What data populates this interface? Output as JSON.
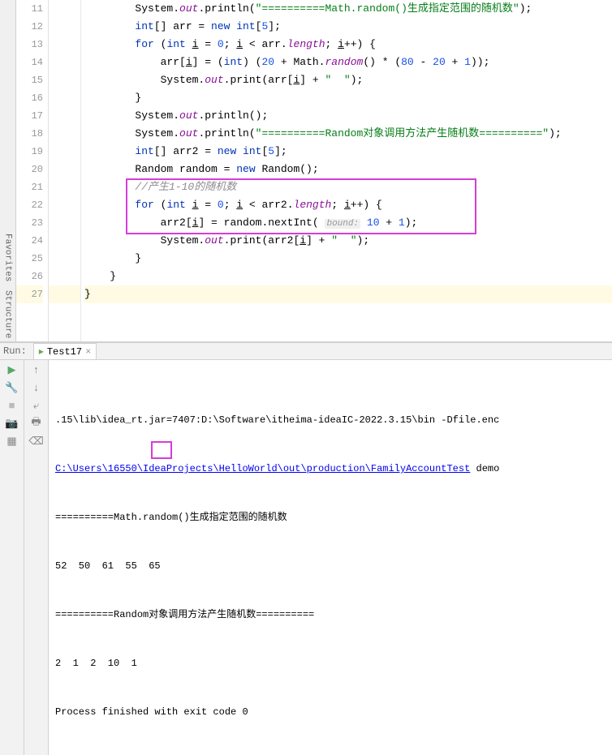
{
  "sidebar": {
    "structure": "Structure",
    "favorites": "Favorites"
  },
  "gutter": [
    "11",
    "12",
    "13",
    "14",
    "15",
    "16",
    "17",
    "18",
    "19",
    "20",
    "21",
    "22",
    "23",
    "24",
    "25",
    "26",
    "27"
  ],
  "code": {
    "l11_a": "        System.",
    "l11_b": "out",
    "l11_c": ".println(",
    "l11_d": "\"==========Math.random()生成指定范围的随机数\"",
    "l11_e": ");",
    "l12_a": "        ",
    "l12_b": "int",
    "l12_c": "[] arr = ",
    "l12_d": "new int",
    "l12_e": "[",
    "l12_f": "5",
    "l12_g": "];",
    "l13_a": "        ",
    "l13_b": "for",
    "l13_c": " (",
    "l13_d": "int",
    "l13_e": " ",
    "l13_f": "i",
    "l13_g": " = ",
    "l13_h": "0",
    "l13_i": "; ",
    "l13_j": "i",
    "l13_k": " < arr.",
    "l13_l": "length",
    "l13_m": "; ",
    "l13_n": "i",
    "l13_o": "++) {",
    "l14_a": "            arr[",
    "l14_b": "i",
    "l14_c": "] = (",
    "l14_d": "int",
    "l14_e": ") (",
    "l14_f": "20",
    "l14_g": " + Math.",
    "l14_h": "random",
    "l14_i": "() * (",
    "l14_j": "80",
    "l14_k": " - ",
    "l14_l": "20",
    "l14_m": " + ",
    "l14_n": "1",
    "l14_o": "));",
    "l15_a": "            System.",
    "l15_b": "out",
    "l15_c": ".print(arr[",
    "l15_d": "i",
    "l15_e": "] + ",
    "l15_f": "\"  \"",
    "l15_g": ");",
    "l16": "        }",
    "l17_a": "        System.",
    "l17_b": "out",
    "l17_c": ".println();",
    "l18_a": "        System.",
    "l18_b": "out",
    "l18_c": ".println(",
    "l18_d": "\"==========Random对象调用方法产生随机数==========\"",
    "l18_e": ");",
    "l19_a": "        ",
    "l19_b": "int",
    "l19_c": "[] arr2 = ",
    "l19_d": "new int",
    "l19_e": "[",
    "l19_f": "5",
    "l19_g": "];",
    "l20_a": "        Random random = ",
    "l20_b": "new",
    "l20_c": " Random();",
    "l21_a": "        ",
    "l21_b": "//产生1-10的随机数",
    "l22_a": "        ",
    "l22_b": "for",
    "l22_c": " (",
    "l22_d": "int",
    "l22_e": " ",
    "l22_f": "i",
    "l22_g": " = ",
    "l22_h": "0",
    "l22_i": "; ",
    "l22_j": "i",
    "l22_k": " < arr2.",
    "l22_l": "length",
    "l22_m": "; ",
    "l22_n": "i",
    "l22_o": "++) {",
    "l23_a": "            arr2[",
    "l23_b": "i",
    "l23_c": "] = random.nextInt( ",
    "l23_d": "bound:",
    "l23_e": " ",
    "l23_f": "10",
    "l23_g": " + ",
    "l23_h": "1",
    "l23_i": ");",
    "l24_a": "            System.",
    "l24_b": "out",
    "l24_c": ".print(arr2[",
    "l24_d": "i",
    "l24_e": "] + ",
    "l24_f": "\"  \"",
    "l24_g": ");",
    "l25": "        }",
    "l26": "    }",
    "l27": "}"
  },
  "run": {
    "label": "Run:",
    "tab": "Test17",
    "close": "×"
  },
  "console": {
    "l1": ".15\\lib\\idea_rt.jar=7407:D:\\Software\\itheima-ideaIC-2022.3.15\\bin -Dfile.enc",
    "l2": "C:\\Users\\16550\\IdeaProjects\\HelloWorld\\out\\production\\FamilyAccountTest",
    "l2b": " demo",
    "l3": "==========Math.random()生成指定范围的随机数",
    "l4": "52  50  61  55  65  ",
    "l5": "==========Random对象调用方法产生随机数==========",
    "l6": "2  1  2  10  1  ",
    "l7": "Process finished with exit code 0"
  }
}
